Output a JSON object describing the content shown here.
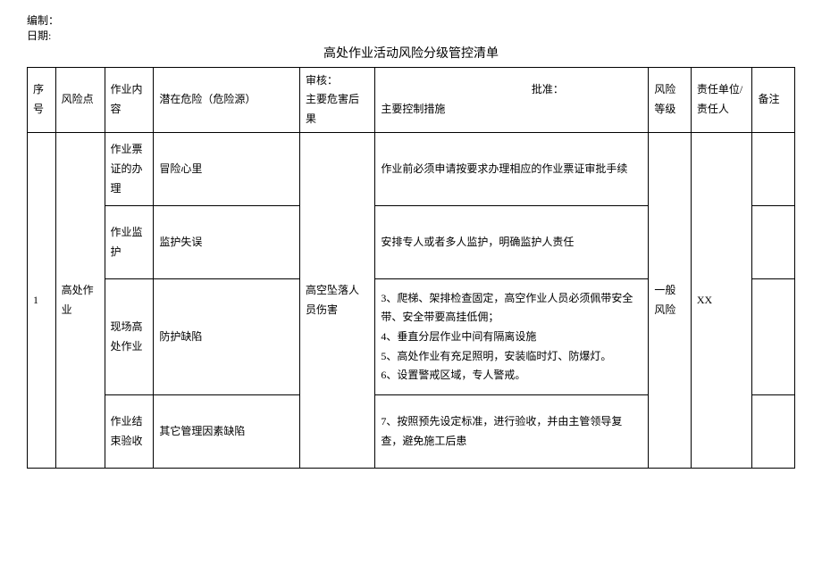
{
  "header": {
    "compile": "编制：",
    "date": "日期:",
    "audit": "审核：",
    "approve": "批准：",
    "title": "高处作业活动风险分级管控清单"
  },
  "columns": {
    "xh": "序号",
    "fxd": "风险点",
    "zynr": "作业内容",
    "qzwx": "潜在危险（危险源）",
    "zywh": "主要危害后果",
    "zykz": "主要控制措施",
    "fxdj": "风险等级",
    "zrdw": "责任单位/责任人",
    "bz": "备注"
  },
  "rows": {
    "seq": "1",
    "riskPoint": "高处作业",
    "hazardResult": "高空坠落人员伤害",
    "riskLevel": "一般风险",
    "responsible": "XX",
    "items": [
      {
        "content": "作业票证的办理",
        "danger": "冒险心里",
        "control": "作业前必须申请按要求办理相应的作业票证审批手续",
        "remark": ""
      },
      {
        "content": "作业监护",
        "danger": "监护失误",
        "control": "安排专人或者多人监护，明确监护人责任",
        "remark": ""
      },
      {
        "content": "现场高处作业",
        "danger": "防护缺陷",
        "control": "3、爬梯、架排检查固定，高空作业人员必须佩带安全带、安全带要高挂低佣；\n4、垂直分层作业中间有隔离设施\n5、高处作业有充足照明，安装临时灯、防爆灯。\n6、设置警戒区域，专人警戒。",
        "remark": ""
      },
      {
        "content": "作业结束验收",
        "danger": "其它管理因素缺陷",
        "control": "7、按照预先设定标准，进行验收，并由主管领导复查，避免施工后患",
        "remark": ""
      }
    ]
  }
}
